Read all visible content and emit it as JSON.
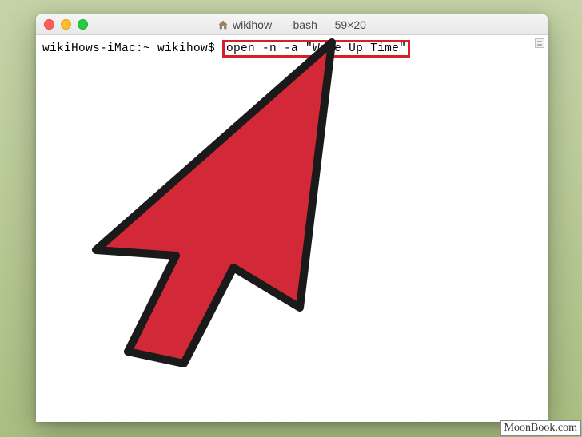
{
  "window": {
    "title": "wikihow — -bash — 59×20"
  },
  "terminal": {
    "prompt": "wikiHows-iMac:~ wikihow$ ",
    "command": "open -n -a \"Wake Up Time\""
  },
  "watermark": {
    "text": "MoonBook.com"
  }
}
